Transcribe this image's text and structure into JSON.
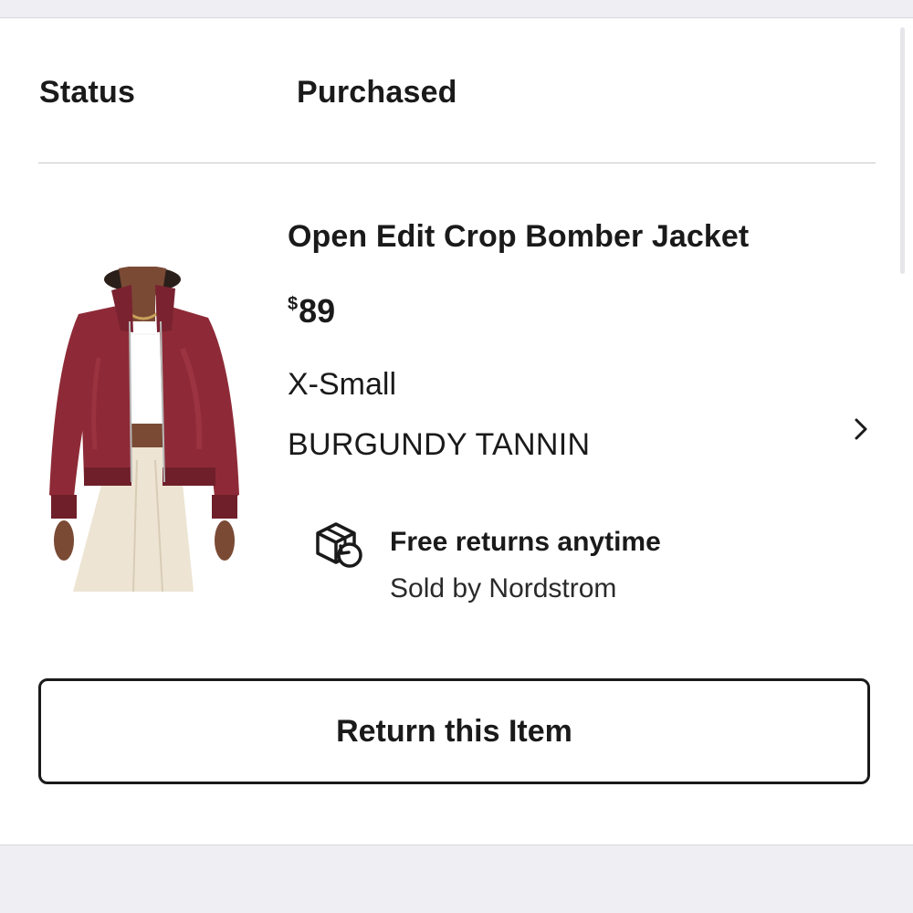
{
  "order_item": {
    "status_label": "Status",
    "status_value": "Purchased",
    "product_name": "Open Edit Crop Bomber Jacket",
    "price_currency": "$",
    "price_amount": "89",
    "size": "X-Small",
    "color": "BURGUNDY TANNIN",
    "returns_title": "Free returns anytime",
    "sold_by": "Sold by Nordstrom",
    "return_button_label": "Return this Item"
  },
  "icons": {
    "details": "chevron-right-icon",
    "returns": "package-return-icon"
  },
  "colors": {
    "text": "#1a1a1a",
    "divider": "#c8c8cc",
    "page_background": "#eeeef3",
    "jacket": "#8e2a37"
  }
}
